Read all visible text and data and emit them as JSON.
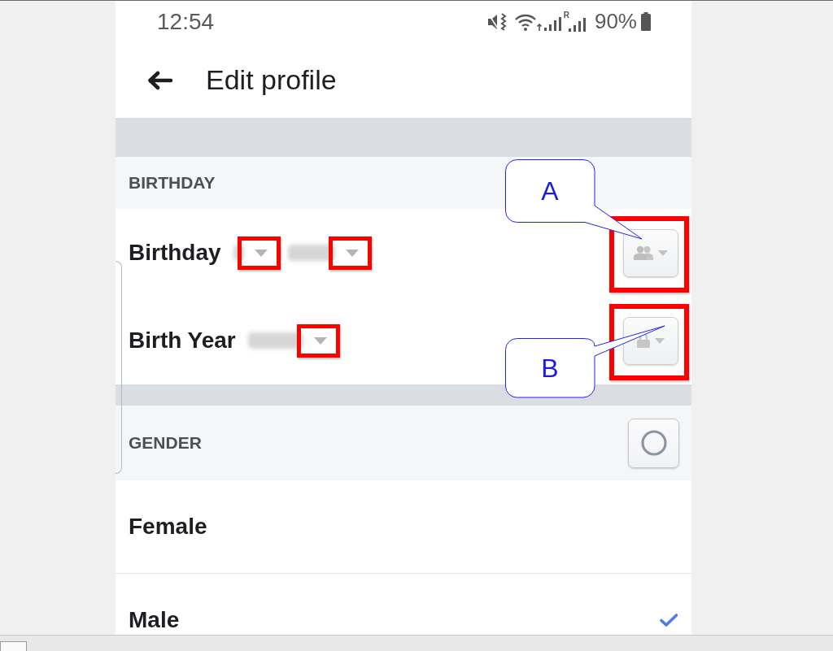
{
  "status_bar": {
    "time": "12:54",
    "roaming": "R",
    "battery": "90%"
  },
  "header": {
    "title": "Edit profile"
  },
  "birthday_section": {
    "heading": "BIRTHDAY",
    "rows": [
      {
        "label": "Birthday",
        "selects": [
          {
            "kind": "day",
            "highlighted": true
          },
          {
            "kind": "month",
            "highlighted": true
          }
        ],
        "privacy": {
          "kind": "people",
          "highlighted": true
        },
        "callout": {
          "letter": "A",
          "kind": "above"
        }
      },
      {
        "label": "Birth Year",
        "selects": [
          {
            "kind": "year",
            "highlighted": true
          }
        ],
        "privacy": {
          "kind": "lock",
          "highlighted": true
        },
        "callout": {
          "letter": "B",
          "kind": "below"
        }
      }
    ]
  },
  "gender_section": {
    "heading": "GENDER",
    "options": [
      {
        "label": "Female",
        "selected": false
      },
      {
        "label": "Male",
        "selected": true
      }
    ]
  }
}
